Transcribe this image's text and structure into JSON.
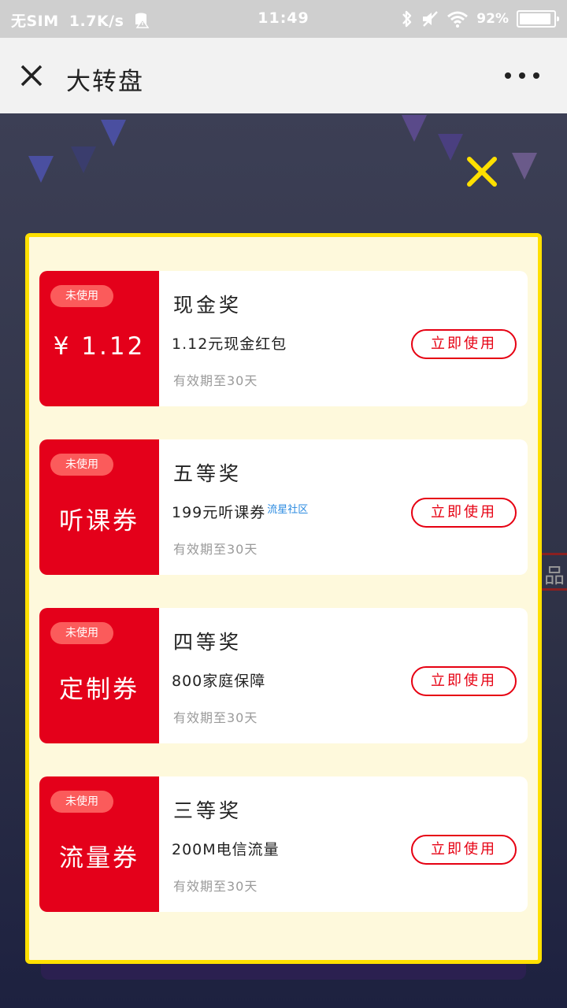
{
  "status_bar": {
    "carrier": "无SIM",
    "speed": "1.7K/s",
    "time": "11:49",
    "battery_text": "92",
    "battery_level": 0.92
  },
  "app_bar": {
    "title": "大转盘"
  },
  "background": {
    "side_label": "品"
  },
  "prizes": [
    {
      "badge": "未使用",
      "value": "¥ 1.12",
      "name": "现金奖",
      "description": "1.12元现金红包",
      "tag": "",
      "validity": "有效期至30天",
      "action": "立即使用"
    },
    {
      "badge": "未使用",
      "value": "听课券",
      "name": "五等奖",
      "description": "199元听课券",
      "tag": "流星社区",
      "validity": "有效期至30天",
      "action": "立即使用"
    },
    {
      "badge": "未使用",
      "value": "定制券",
      "name": "四等奖",
      "description": "800家庭保障",
      "tag": "",
      "validity": "有效期至30天",
      "action": "立即使用"
    },
    {
      "badge": "未使用",
      "value": "流量券",
      "name": "三等奖",
      "description": "200M电信流量",
      "tag": "",
      "validity": "有效期至30天",
      "action": "立即使用"
    }
  ],
  "colors": {
    "stub_red": "#e4001a",
    "modal_bg": "#fef9dc",
    "modal_border": "#ffe000",
    "action_red": "#e60012"
  }
}
